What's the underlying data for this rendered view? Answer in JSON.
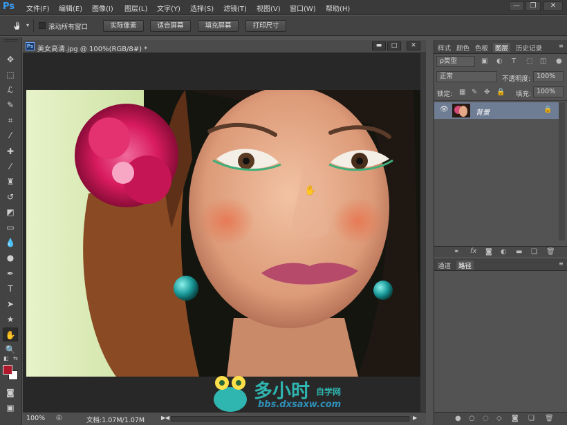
{
  "app": {
    "logo": "Ps"
  },
  "menu": [
    "文件(F)",
    "编辑(E)",
    "图像(I)",
    "图层(L)",
    "文字(Y)",
    "选择(S)",
    "滤镜(T)",
    "视图(V)",
    "窗口(W)",
    "帮助(H)"
  ],
  "window_controls": {
    "minimize": "—",
    "restore": "❐",
    "close": "✕"
  },
  "options_bar": {
    "scroll_all_windows": "滚动所有窗口",
    "actual_pixels": "实际像素",
    "fit_screen": "适合屏幕",
    "fill_screen": "填充屏幕",
    "print_size": "打印尺寸"
  },
  "document": {
    "title": "美女高清.jpg @ 100%(RGB/8#) *",
    "ps_icon": "Ps",
    "zoom": "100%",
    "doc_info": "文档:1.07M/1.07M"
  },
  "panels_top": {
    "tabs": [
      "样式",
      "颜色",
      "色板",
      "图层",
      "历史记录"
    ],
    "active_tab": "图层",
    "filter_kind": "ρ类型",
    "blend_mode": "正常",
    "opacity_label": "不透明度:",
    "opacity_value": "100%",
    "lock_label": "锁定:",
    "fill_label": "填充:",
    "fill_value": "100%",
    "layer_name": "背景"
  },
  "panels_bottom": {
    "tabs": [
      "通道",
      "路径"
    ],
    "active_tab": "路径"
  },
  "watermark": {
    "brand": "多小时",
    "sub": "自学网",
    "url": "bbs.dxsaxw.com"
  },
  "colors": {
    "foreground": "#b0192b",
    "background": "#ffffff",
    "accent": "#3a9cf0"
  }
}
